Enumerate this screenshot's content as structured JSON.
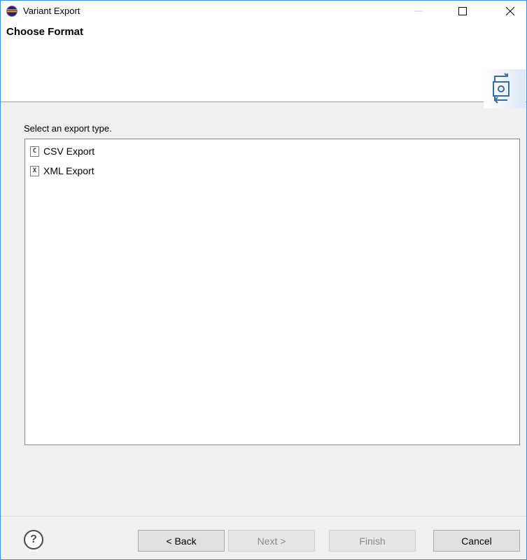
{
  "window": {
    "title": "Variant Export",
    "icon": "eclipse-icon"
  },
  "header": {
    "page_title": "Choose Format",
    "banner_icon": "export-wizard-icon"
  },
  "main": {
    "label": "Select an export type.",
    "items": [
      {
        "icon_letter": "C",
        "label": "CSV Export"
      },
      {
        "icon_letter": "X",
        "label": "XML Export"
      }
    ]
  },
  "footer": {
    "help": "?",
    "back_label": "< Back",
    "next_label": "Next >",
    "finish_label": "Finish",
    "cancel_label": "Cancel"
  }
}
